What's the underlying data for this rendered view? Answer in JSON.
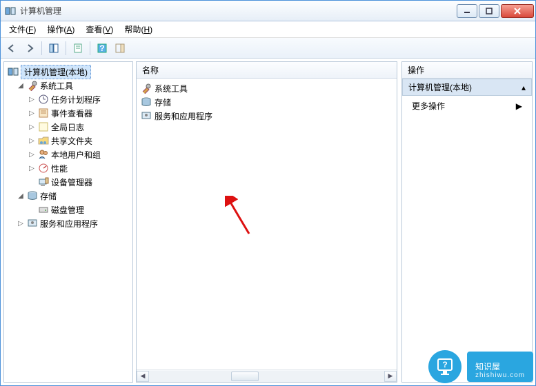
{
  "window": {
    "title": "计算机管理"
  },
  "menu": {
    "file": {
      "label": "文件",
      "key": "F"
    },
    "action": {
      "label": "操作",
      "key": "A"
    },
    "view": {
      "label": "查看",
      "key": "V"
    },
    "help": {
      "label": "帮助",
      "key": "H"
    }
  },
  "tree": {
    "root": "计算机管理(本地)",
    "system_tools": "系统工具",
    "task_scheduler": "任务计划程序",
    "event_viewer": "事件查看器",
    "global_log": "全局日志",
    "shared_folders": "共享文件夹",
    "local_users": "本地用户和组",
    "performance": "性能",
    "device_manager": "设备管理器",
    "storage": "存储",
    "disk_mgmt": "磁盘管理",
    "services_apps": "服务和应用程序"
  },
  "mid": {
    "header": "名称",
    "rows": {
      "r0": "系统工具",
      "r1": "存储",
      "r2": "服务和应用程序"
    }
  },
  "right": {
    "header": "操作",
    "section": "计算机管理(本地)",
    "more": "更多操作"
  },
  "watermark": {
    "brand": "知识屋",
    "url": "zhishiwu.com"
  }
}
